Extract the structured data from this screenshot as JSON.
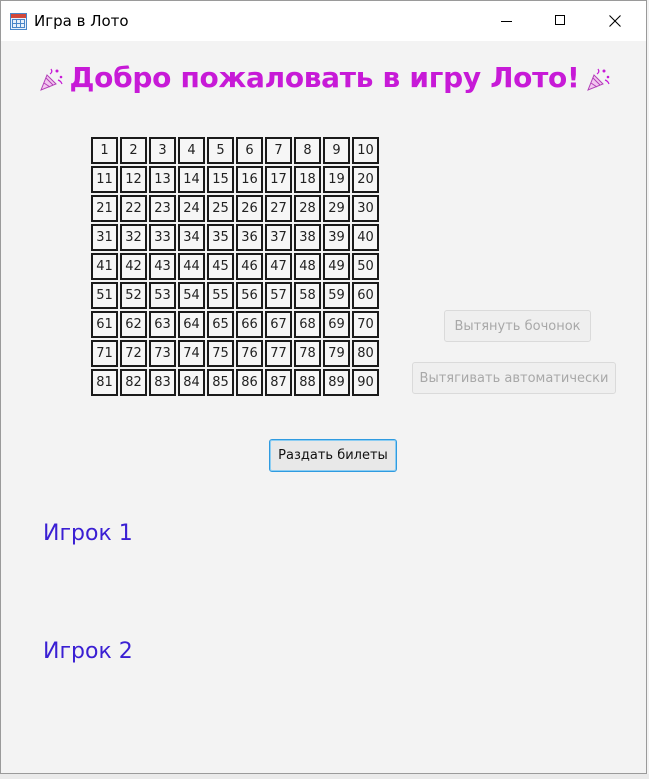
{
  "window": {
    "title": "Игра в Лото",
    "icon": "lotto-calendar-icon",
    "controls": [
      "minimize-icon",
      "maximize-icon",
      "close-icon"
    ]
  },
  "heading": {
    "text": "Добро пожаловать в игру Лото!",
    "decoration_icon": "party-popper-icon",
    "color": "#c71ad7"
  },
  "board": {
    "numbers": [
      "1",
      "2",
      "3",
      "4",
      "5",
      "6",
      "7",
      "8",
      "9",
      "10",
      "11",
      "12",
      "13",
      "14",
      "15",
      "16",
      "17",
      "18",
      "19",
      "20",
      "21",
      "22",
      "23",
      "24",
      "25",
      "26",
      "27",
      "28",
      "29",
      "30",
      "31",
      "32",
      "33",
      "34",
      "35",
      "36",
      "37",
      "38",
      "39",
      "40",
      "41",
      "42",
      "43",
      "44",
      "45",
      "46",
      "47",
      "48",
      "49",
      "50",
      "51",
      "52",
      "53",
      "54",
      "55",
      "56",
      "57",
      "58",
      "59",
      "60",
      "61",
      "62",
      "63",
      "64",
      "65",
      "66",
      "67",
      "68",
      "69",
      "70",
      "71",
      "72",
      "73",
      "74",
      "75",
      "76",
      "77",
      "78",
      "79",
      "80",
      "81",
      "82",
      "83",
      "84",
      "85",
      "86",
      "87",
      "88",
      "89",
      "90"
    ]
  },
  "buttons": {
    "draw_barrel": {
      "label": "Вытянуть бочонок",
      "enabled": false
    },
    "auto_draw": {
      "label": "Вытягивать автоматически",
      "enabled": false
    },
    "deal_tickets": {
      "label": "Раздать билеты",
      "enabled": true,
      "focused": true
    }
  },
  "players": [
    {
      "label": "Игрок 1"
    },
    {
      "label": "Игрок 2"
    }
  ],
  "colors": {
    "player_label": "#3a1fd3",
    "focus_border": "#2f9be0"
  }
}
